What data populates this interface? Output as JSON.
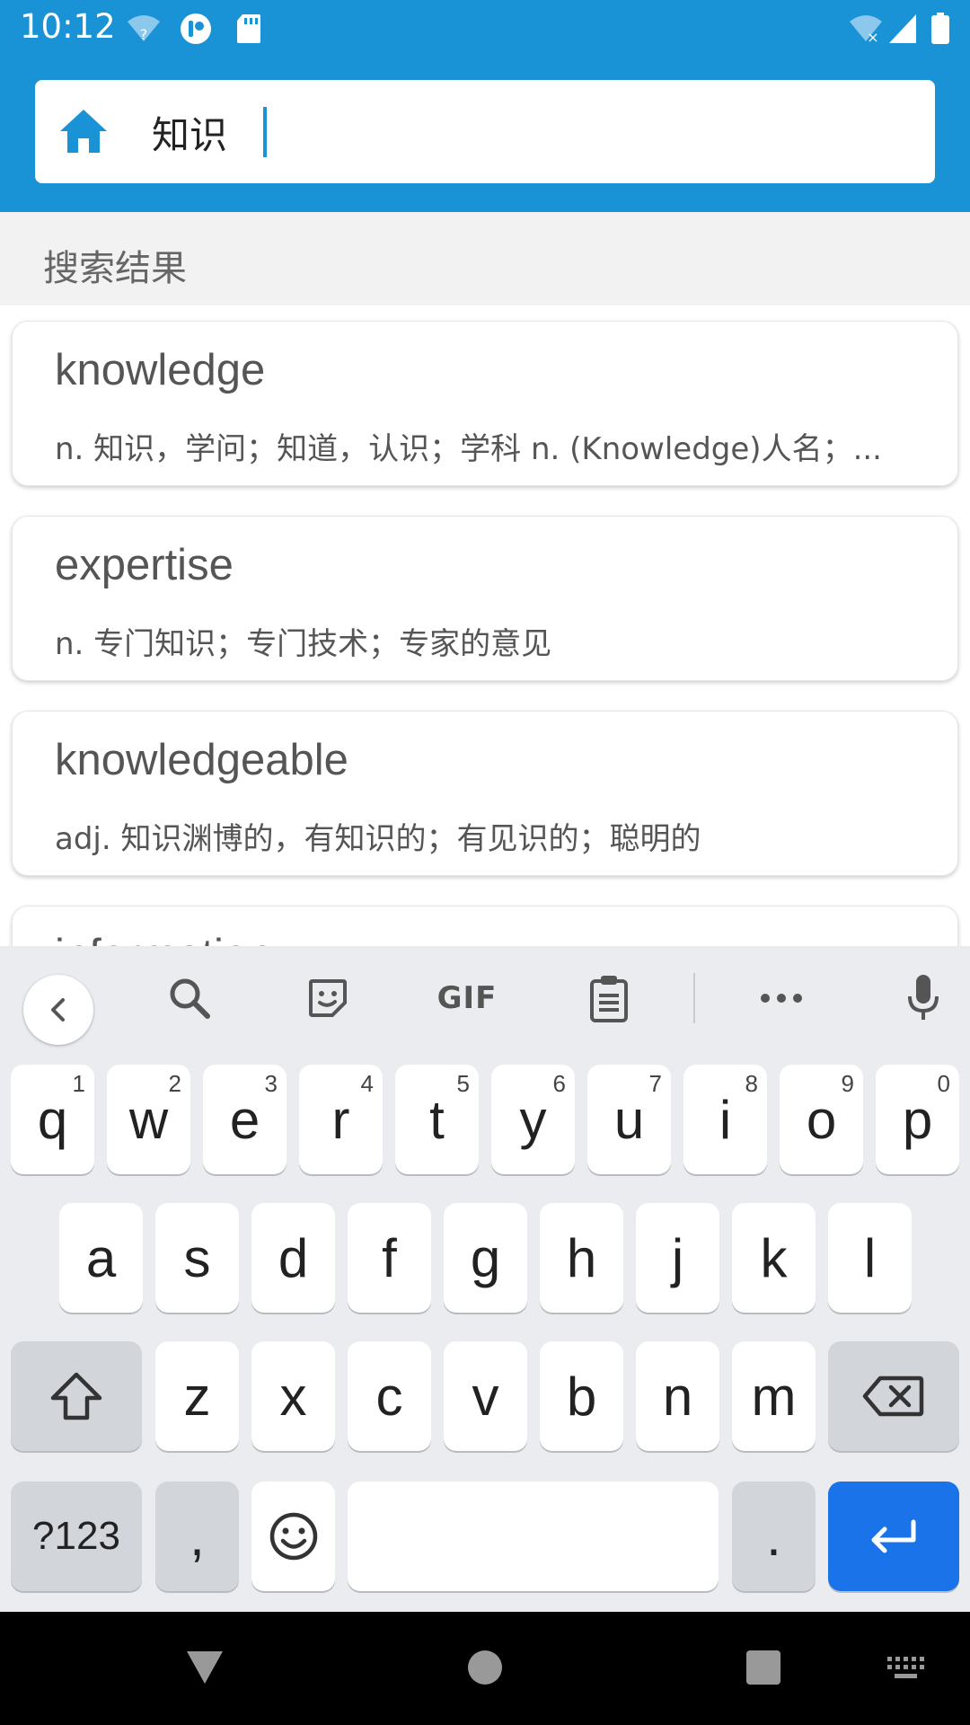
{
  "status_bar": {
    "time": "10:12"
  },
  "search": {
    "query": "知识",
    "home_icon": "home-icon"
  },
  "section": {
    "title": "搜索结果"
  },
  "results": [
    {
      "word": "knowledge",
      "definition": "n. 知识，学问；知道，认识；学科 n. (Knowledge)人名；..."
    },
    {
      "word": "expertise",
      "definition": "n. 专门知识；专门技术；专家的意见"
    },
    {
      "word": "knowledgeable",
      "definition": "adj. 知识渊博的，有知识的；有见识的；聪明的"
    },
    {
      "word": "information",
      "definition": ""
    }
  ],
  "keyboard": {
    "toolbar_gif": "GIF",
    "row1": [
      {
        "key": "q",
        "hint": "1"
      },
      {
        "key": "w",
        "hint": "2"
      },
      {
        "key": "e",
        "hint": "3"
      },
      {
        "key": "r",
        "hint": "4"
      },
      {
        "key": "t",
        "hint": "5"
      },
      {
        "key": "y",
        "hint": "6"
      },
      {
        "key": "u",
        "hint": "7"
      },
      {
        "key": "i",
        "hint": "8"
      },
      {
        "key": "o",
        "hint": "9"
      },
      {
        "key": "p",
        "hint": "0"
      }
    ],
    "row2": [
      "a",
      "s",
      "d",
      "f",
      "g",
      "h",
      "j",
      "k",
      "l"
    ],
    "row3": [
      "z",
      "x",
      "c",
      "v",
      "b",
      "n",
      "m"
    ],
    "symbols_label": "?123",
    "comma": ",",
    "period": "."
  },
  "colors": {
    "accent": "#1a93d6",
    "enter": "#1a73e8"
  }
}
